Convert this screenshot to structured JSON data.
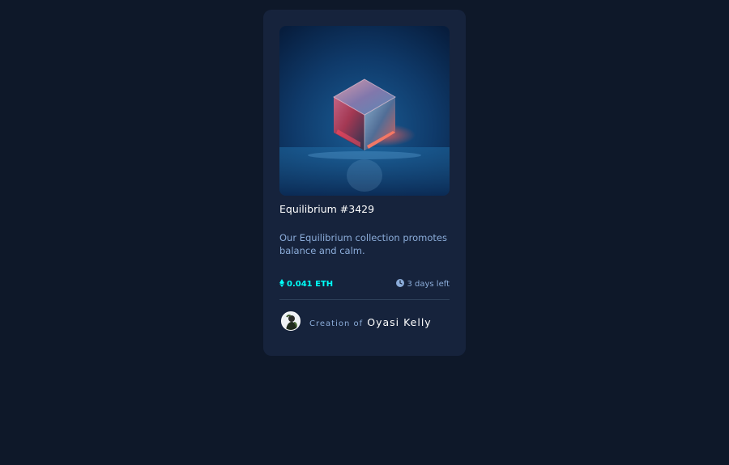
{
  "card": {
    "image_alt": "Equilibrium cube artwork",
    "title": "Equilibrium #3429",
    "description": "Our Equilibrium collection promotes balance and calm.",
    "price": "0.041 ETH",
    "time_left": "3 days left",
    "creator_prefix": "Creation of",
    "creator_name": "Oyasi Kelly"
  },
  "icons": {
    "price": "ethereum-icon",
    "time": "clock-icon",
    "avatar": "avatar"
  },
  "colors": {
    "page_background": "#0e1829",
    "card_background": "#16233c",
    "accent_cyan": "#00fff8",
    "soft_blue": "#8bacd9",
    "divider": "#2e405a",
    "white": "#ffffff"
  }
}
